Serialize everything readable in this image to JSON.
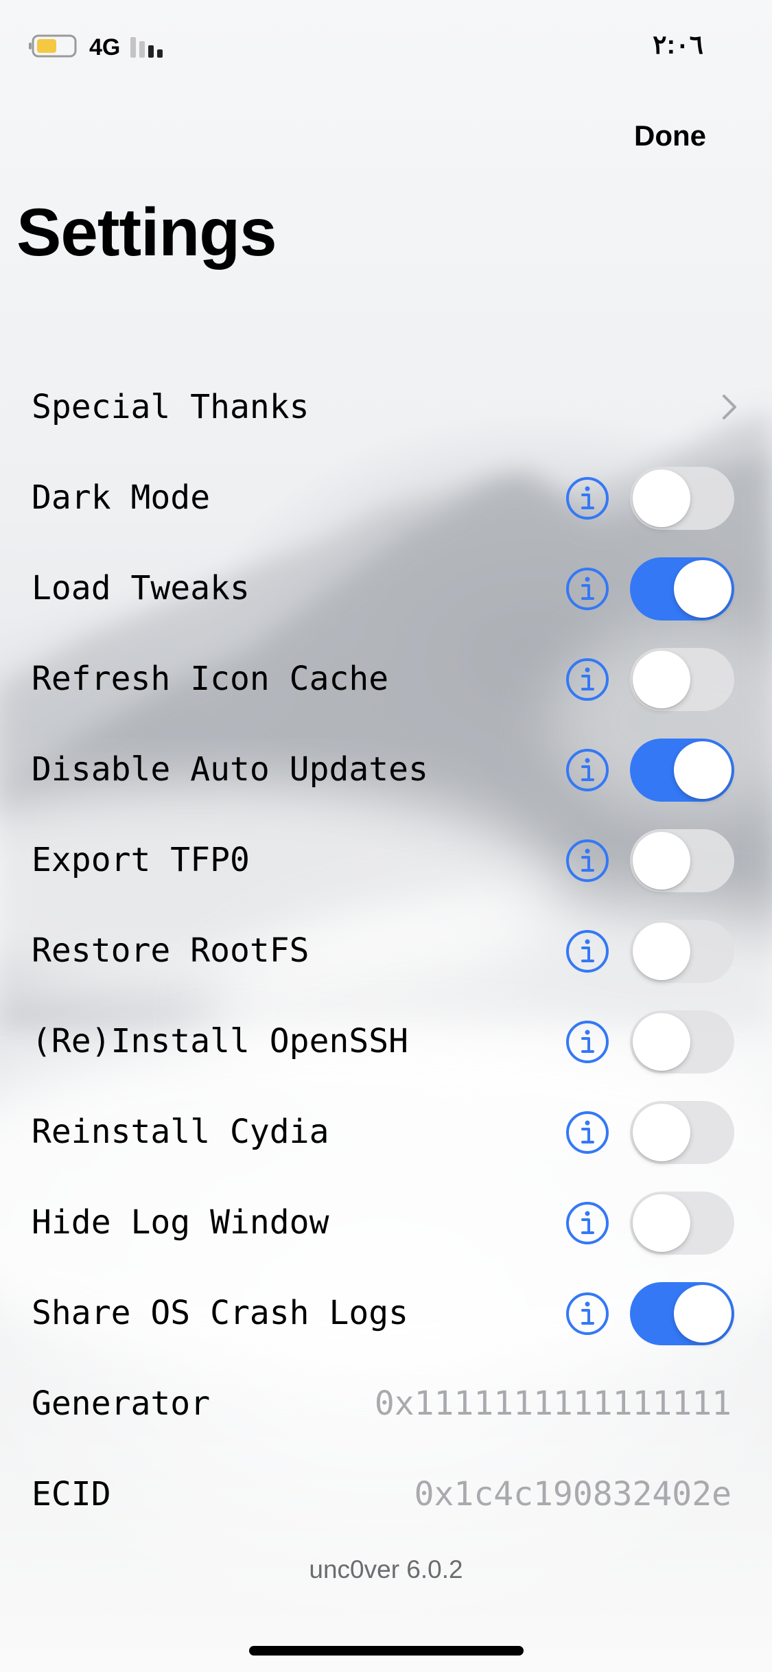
{
  "status_bar": {
    "network": "4G",
    "time": "٢:٠٦"
  },
  "nav": {
    "done_label": "Done",
    "title": "Settings"
  },
  "rows": [
    {
      "label": "Special Thanks",
      "kind": "link"
    },
    {
      "label": "Dark Mode",
      "kind": "toggle",
      "on": false
    },
    {
      "label": "Load Tweaks",
      "kind": "toggle",
      "on": true
    },
    {
      "label": "Refresh Icon Cache",
      "kind": "toggle",
      "on": false
    },
    {
      "label": "Disable Auto Updates",
      "kind": "toggle",
      "on": true
    },
    {
      "label": "Export TFP0",
      "kind": "toggle",
      "on": false
    },
    {
      "label": "Restore RootFS",
      "kind": "toggle",
      "on": false
    },
    {
      "label": "(Re)Install OpenSSH",
      "kind": "toggle",
      "on": false
    },
    {
      "label": "Reinstall Cydia",
      "kind": "toggle",
      "on": false
    },
    {
      "label": "Hide Log Window",
      "kind": "toggle",
      "on": false
    },
    {
      "label": "Share OS Crash Logs",
      "kind": "toggle",
      "on": true
    },
    {
      "label": "Generator",
      "kind": "value",
      "value": "0x1111111111111111"
    },
    {
      "label": "ECID",
      "kind": "value",
      "value": "0x1c4c190832402e"
    }
  ],
  "footer": {
    "version": "unc0ver 6.0.2"
  },
  "colors": {
    "accent": "#3478f6",
    "toggle_off": "#e2e2e4",
    "value_text": "#a9a9ae"
  },
  "icons": {
    "info": "info-circle-icon",
    "chevron": "chevron-right-icon"
  }
}
